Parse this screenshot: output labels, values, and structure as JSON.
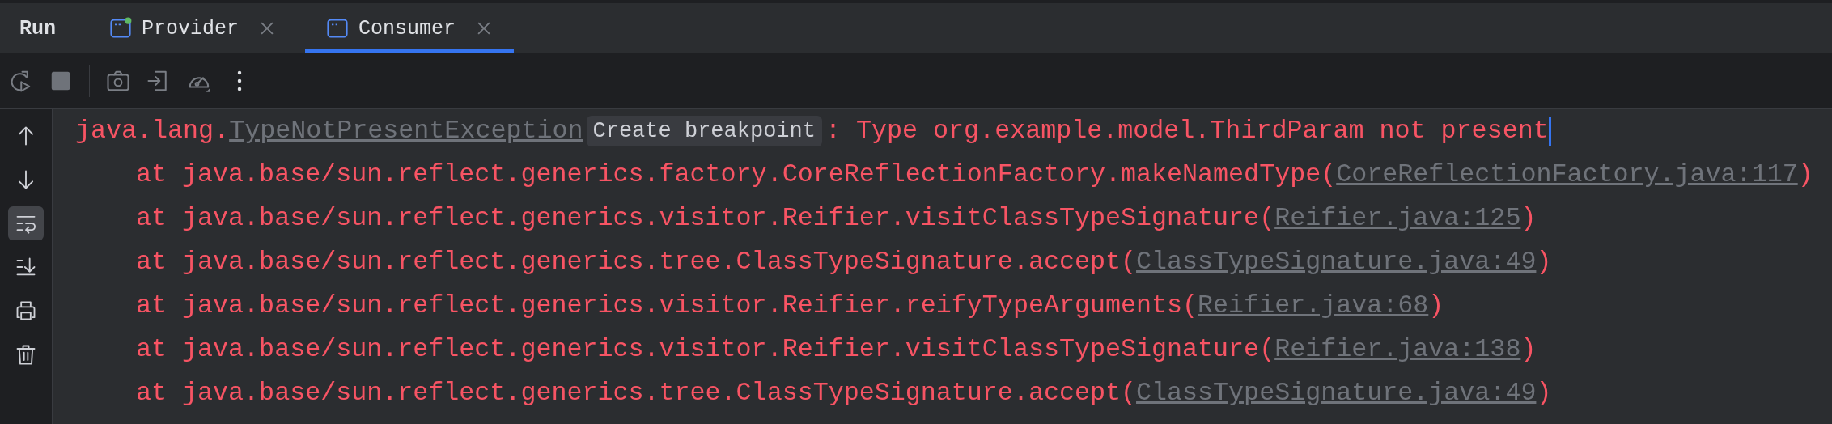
{
  "panel": {
    "title": "Run"
  },
  "tabs": [
    {
      "label": "Provider",
      "selected": false,
      "running": true
    },
    {
      "label": "Consumer",
      "selected": true,
      "running": false
    }
  ],
  "toolbar": [
    {
      "kind": "rerun"
    },
    {
      "kind": "stop"
    },
    {
      "kind": "separator"
    },
    {
      "kind": "camera"
    },
    {
      "kind": "exit"
    },
    {
      "kind": "gauge"
    },
    {
      "kind": "more"
    }
  ],
  "gutter": [
    {
      "kind": "up",
      "on": false
    },
    {
      "kind": "down",
      "on": false
    },
    {
      "kind": "wrap",
      "on": true
    },
    {
      "kind": "scroll-end",
      "on": false
    },
    {
      "kind": "print",
      "on": false
    },
    {
      "kind": "trash",
      "on": false
    }
  ],
  "console": {
    "lines": [
      {
        "kind": "exception",
        "prefix": "java.lang.",
        "link": "TypeNotPresentException",
        "hint": "Create breakpoint",
        "message": ": Type org.example.model.ThirdParam not present"
      },
      {
        "kind": "frame",
        "text": "at java.base/sun.reflect.generics.factory.CoreReflectionFactory.makeNamedType(",
        "link": "CoreReflectionFactory.java:117",
        "suffix": ")"
      },
      {
        "kind": "frame",
        "text": "at java.base/sun.reflect.generics.visitor.Reifier.visitClassTypeSignature(",
        "link": "Reifier.java:125",
        "suffix": ")"
      },
      {
        "kind": "frame",
        "text": "at java.base/sun.reflect.generics.tree.ClassTypeSignature.accept(",
        "link": "ClassTypeSignature.java:49",
        "suffix": ")"
      },
      {
        "kind": "frame",
        "text": "at java.base/sun.reflect.generics.visitor.Reifier.reifyTypeArguments(",
        "link": "Reifier.java:68",
        "suffix": ")"
      },
      {
        "kind": "frame",
        "text": "at java.base/sun.reflect.generics.visitor.Reifier.visitClassTypeSignature(",
        "link": "Reifier.java:138",
        "suffix": ")"
      },
      {
        "kind": "frame",
        "text": "at java.base/sun.reflect.generics.tree.ClassTypeSignature.accept(",
        "link": "ClassTypeSignature.java:49",
        "suffix": ")"
      }
    ]
  }
}
